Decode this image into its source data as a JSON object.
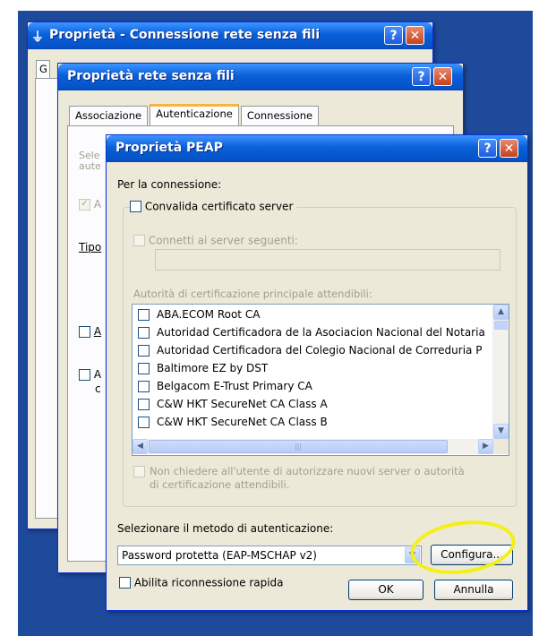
{
  "window1": {
    "title": "Proprietà - Connessione rete senza fili",
    "tab_fragment": "G"
  },
  "window2": {
    "title": "Proprietà rete senza fili",
    "tabs": [
      {
        "label": "Associazione"
      },
      {
        "label": "Autenticazione"
      },
      {
        "label": "Connessione"
      }
    ],
    "frag_line1": "Sele",
    "frag_line2": "aute",
    "frag_check": "A",
    "frag_tipo": "Tipo",
    "frag_a1": "A",
    "frag_a2": "A",
    "frag_c": "c"
  },
  "dialog": {
    "title": "Proprietà PEAP",
    "help_glyph": "?",
    "close_glyph": "✕",
    "for_connection_label": "Per la connessione:",
    "validate_cert_label": "Convalida certificato server",
    "connect_servers_label": "Connetti ai server seguenti:",
    "server_input_value": "",
    "trusted_root_label": "Autorità di certificazione principale attendibili:",
    "ca_list": [
      "ABA.ECOM Root CA",
      "Autoridad Certificadora de la Asociacion Nacional del Notaria",
      "Autoridad Certificadora del Colegio Nacional de Correduria P",
      "Baltimore EZ by DST",
      "Belgacom E-Trust Primary CA",
      "C&W HKT SecureNet CA Class A",
      "C&W HKT SecureNet CA Class B"
    ],
    "hscroll_grip": "|||",
    "no_prompt_label_line1": "Non chiedere all'utente di autorizzare nuovi server o autorità",
    "no_prompt_label_line2": "di certificazione attendibili.",
    "auth_method_label": "Selezionare il metodo di autenticazione:",
    "auth_method_value": "Password protetta (EAP-MSCHAP v2)",
    "configure_button": "Configura...",
    "fast_reconnect_label": "Abilita riconnessione rapida",
    "ok_button": "OK",
    "cancel_button": "Annulla"
  },
  "colors": {
    "titlebar": "#0553c8",
    "dialog_bg": "#ece9d8",
    "highlight": "#f3f018"
  }
}
